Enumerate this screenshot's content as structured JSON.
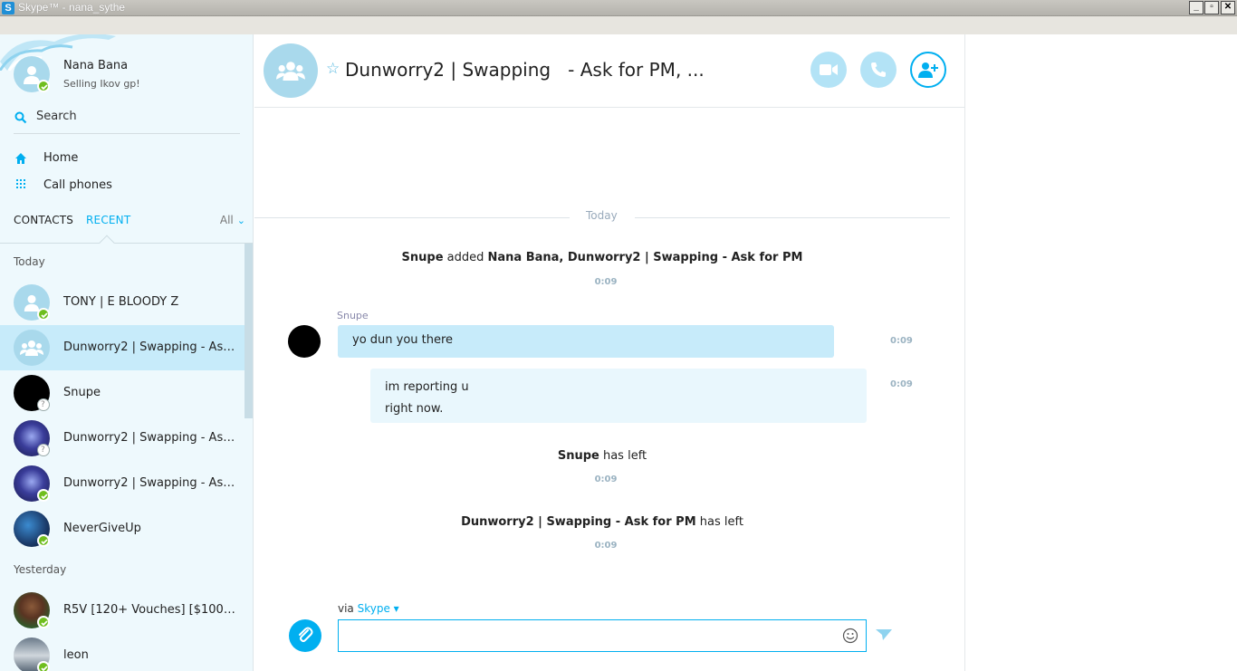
{
  "window": {
    "title": "Skype™ - nana_sythe",
    "app_icon": "S",
    "minimize": "_",
    "restore": "▫",
    "close": "✕"
  },
  "profile": {
    "name": "Nana Bana",
    "status": "Selling Ikov gp!"
  },
  "search": {
    "label": "Search"
  },
  "nav": [
    {
      "label": "Home",
      "icon": "home-icon"
    },
    {
      "label": "Call phones",
      "icon": "dialpad-icon"
    }
  ],
  "tabs": {
    "contacts": "CONTACTS",
    "recent": "RECENT",
    "filter": "All"
  },
  "sections": {
    "today": "Today",
    "yesterday": "Yesterday"
  },
  "contacts": [
    {
      "name": "TONY | E BLOODY Z",
      "presence": "online"
    },
    {
      "name": "Dunworry2 | Swapping   - Ask for PM",
      "presence": "group",
      "selected": true
    },
    {
      "name": "Snupe",
      "presence": "unknown"
    },
    {
      "name": "Dunworry2 | Swapping   - Ask for PM",
      "presence": "unknown"
    },
    {
      "name": "Dunworry2 | Swapping   - Ask for PM",
      "presence": "online"
    },
    {
      "name": "NeverGiveUp",
      "presence": "online"
    },
    {
      "name": "R5V [120+ Vouches] [$100 Do...",
      "presence": "online"
    },
    {
      "name": "leon",
      "presence": "online"
    }
  ],
  "conversation": {
    "title": "Dunworry2 | Swapping   - Ask for PM, ...",
    "day_label": "Today",
    "added_event": {
      "actor": "Snupe",
      "verb": " added ",
      "targets": "Nana Bana, Dunworry2 | Swapping   - Ask for PM",
      "time": "0:09"
    },
    "sender": "Snupe",
    "messages": [
      {
        "lines": [
          "yo dun you there"
        ],
        "time": "0:09"
      },
      {
        "lines": [
          "im reporting u",
          "right now."
        ],
        "time": "0:09"
      }
    ],
    "left_event_1": {
      "actor": "Snupe",
      "verb": " has left",
      "time": "0:09"
    },
    "left_event_2": {
      "actor": "Dunworry2 | Swapping   - Ask for PM",
      "verb": " has left",
      "time": "0:09"
    }
  },
  "composer": {
    "via_prefix": "via ",
    "via_link": "Skype",
    "placeholder": ""
  },
  "colors": {
    "accent": "#00aff0",
    "sidebar_bg": "#eef9fd",
    "bubble": "#c7ebfa",
    "online": "#6fbe1e"
  }
}
